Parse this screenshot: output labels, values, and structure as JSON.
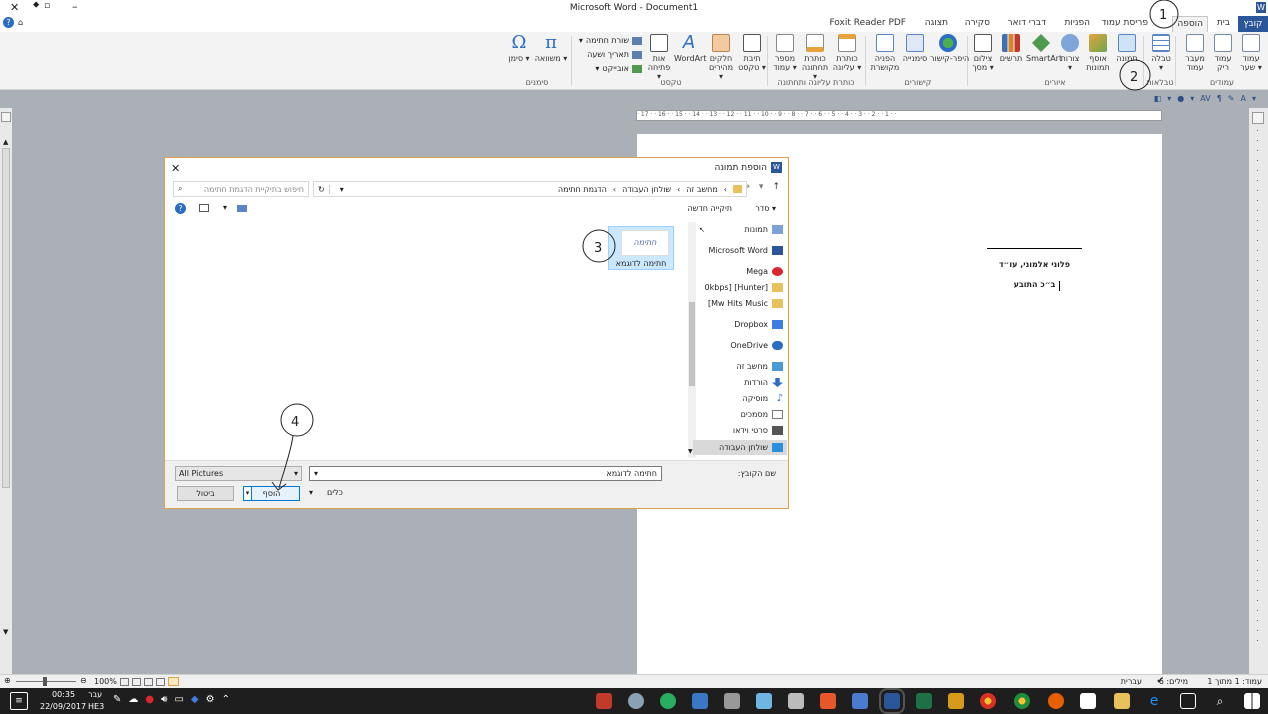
{
  "window": {
    "title": "Microsoft Word - Document1",
    "word_badge": "W"
  },
  "tabs": [
    "קובץ",
    "בית",
    "הוספה",
    "פריסת עמוד",
    "הפניות",
    "דברי דואר",
    "סקירה",
    "תצוגה",
    "Foxit Reader PDF"
  ],
  "ribbon": {
    "pages": {
      "group": "עמודים",
      "items": [
        "עמוד שער",
        "עמוד ריק",
        "מעבר עמוד"
      ]
    },
    "tables": {
      "group": "טבלאות",
      "items": [
        "טבלה"
      ]
    },
    "illustrations": {
      "group": "איורים",
      "items": [
        "תמונה",
        "אוסף תמונות",
        "צורות",
        "SmartArt",
        "תרשים",
        "צילום מסך"
      ]
    },
    "links": {
      "group": "קישורים",
      "items": [
        "היפר-קישור",
        "סימנייה",
        "הפניה מקושרת"
      ]
    },
    "header_footer": {
      "group": "כותרת עליונה ותחתונה",
      "items": [
        "כותרת עליונה",
        "כותרת תחתונה",
        "מספר עמוד"
      ]
    },
    "text": {
      "group": "טקסט",
      "items": [
        "תיבת טקסט",
        "חלקים מהירים",
        "WordArt",
        "אות פתיחה"
      ],
      "small": [
        "שורת חתימה",
        "תאריך ושעה",
        "אובייקט"
      ]
    },
    "symbols": {
      "group": "סימנים",
      "items": [
        "משוואה",
        "סימן"
      ]
    }
  },
  "ruler_text": "· 17 · · 16 · · 15 · · 14 · · 13 · · 12 · · 11 · · 10 · · 9 · · 8 · · 7 · · 6 · · 5 · · 4 · · 3 · · 2 · · 1 · ·",
  "document": {
    "line1": "פלוני אלמוני, עו״ד",
    "line2": "ב״כ התובע"
  },
  "dialog": {
    "title": "הוספת תמונה",
    "breadcrumb": [
      "מחשב זה",
      "שולחן העבודה",
      "הדגמת חתימה"
    ],
    "search_placeholder": "חיפוש בתיקיית הדגמת חתימה",
    "organize": "סדר",
    "new_folder": "תיקייה חדשה",
    "nav_items": [
      "תמונות",
      "Microsoft Word",
      "Mega",
      "0kbps] [Hunter]",
      "Mw Hits Music]",
      "Dropbox",
      "OneDrive",
      "מחשב זה",
      "הורדות",
      "מוסיקה",
      "מסמכים",
      "סרטי וידאו",
      "שולחן העבודה"
    ],
    "file": {
      "name": "חתימה לדוגמא",
      "thumb_text": "חתימה"
    },
    "filename_label": "שם הקובץ:",
    "filename_value": "חתימה לדוגמא",
    "filter": "All Pictures",
    "tools": "כלים",
    "insert": "הוסף",
    "cancel": "ביטול"
  },
  "status": {
    "page": "עמוד: 1 מתוך 1",
    "words": "מילים: 6",
    "lang": "עברית",
    "zoom": "100%"
  },
  "taskbar": {
    "time": "00:35",
    "date": "22/09/2017",
    "lang1": "עבר",
    "lang2": "HE3"
  },
  "annotations": [
    "1",
    "2",
    "3",
    "4"
  ],
  "colors": {
    "word_blue": "#2b579a",
    "dialog_border": "#e0a14b",
    "selection": "#cce8ff"
  }
}
